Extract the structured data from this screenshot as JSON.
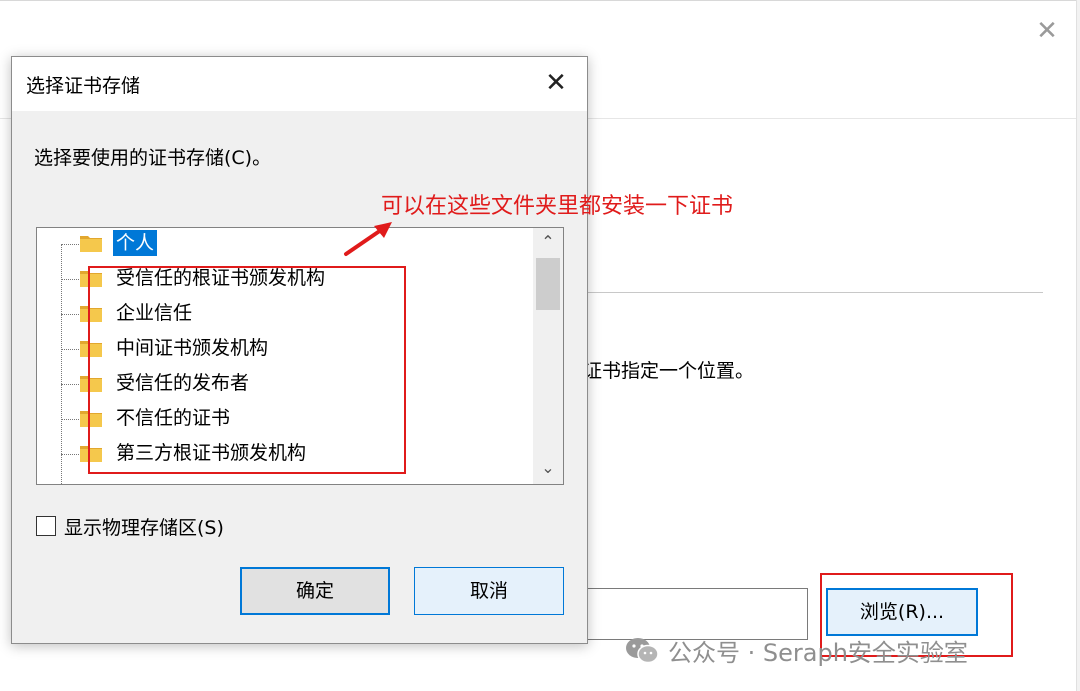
{
  "background_window": {
    "description_fragment": "证书指定一个位置。",
    "browse_label": "浏览(R)..."
  },
  "dialog": {
    "title": "选择证书存储",
    "prompt": "选择要使用的证书存储(C)。",
    "tree_items": [
      {
        "label": "个人",
        "selected": true
      },
      {
        "label": "受信任的根证书颁发机构",
        "selected": false
      },
      {
        "label": "企业信任",
        "selected": false
      },
      {
        "label": "中间证书颁发机构",
        "selected": false
      },
      {
        "label": "受信任的发布者",
        "selected": false
      },
      {
        "label": "不信任的证书",
        "selected": false
      },
      {
        "label": "第三方根证书颁发机构",
        "selected": false
      }
    ],
    "show_physical_label": "显示物理存储区(S)",
    "show_physical_checked": false,
    "ok_label": "确定",
    "cancel_label": "取消"
  },
  "annotation": {
    "text": "可以在这些文件夹里都安装一下证书",
    "color": "#e01b1b"
  },
  "watermark": {
    "text": "公众号 · Seraph安全实验室"
  },
  "colors": {
    "accent": "#0078d7",
    "annotation_red": "#e01b1b",
    "folder": "#f5c84c"
  }
}
